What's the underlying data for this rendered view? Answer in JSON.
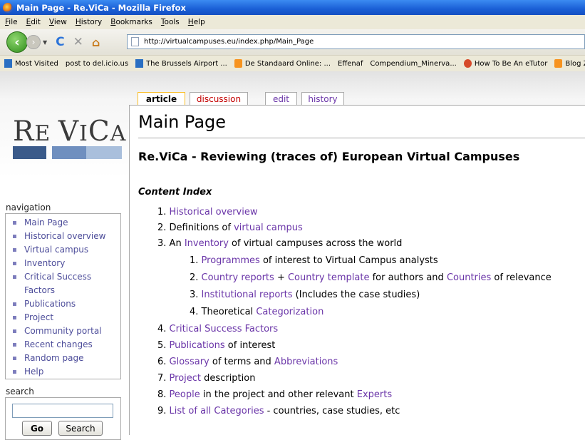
{
  "window": {
    "title": "Main Page - Re.ViCa - Mozilla Firefox"
  },
  "menu": [
    "File",
    "Edit",
    "View",
    "History",
    "Bookmarks",
    "Tools",
    "Help"
  ],
  "address": {
    "url": "http://virtualcampuses.eu/index.php/Main_Page"
  },
  "bookmarks": [
    {
      "label": "Most Visited",
      "icon": "blue"
    },
    {
      "label": "post to del.icio.us",
      "icon": "page"
    },
    {
      "label": "The Brussels Airport ...",
      "icon": "blue"
    },
    {
      "label": "De Standaard Online: ...",
      "icon": "rss"
    },
    {
      "label": "Effenaf",
      "icon": "page"
    },
    {
      "label": "Compendium_Minerva...",
      "icon": "page"
    },
    {
      "label": "How To Be An eTutor",
      "icon": "owl"
    },
    {
      "label": "Blog Zonder N",
      "icon": "rss"
    }
  ],
  "logo": {
    "text_big1": "R",
    "text_small1": "E ",
    "text_big2": "V",
    "text_small2": "I",
    "text_big3": "C",
    "text_small3": "A",
    "colors": [
      "#3a5a8a",
      "#6f8fbf",
      "#a9bfdc"
    ]
  },
  "tabs": {
    "article": "article",
    "discussion": "discussion",
    "edit": "edit",
    "history": "history"
  },
  "sidebar": {
    "navigation_title": "navigation",
    "items": [
      "Main Page",
      "Historical overview",
      "Virtual campus",
      "Inventory",
      "Critical Success",
      "Factors",
      "Publications",
      "Project",
      "Community portal",
      "Recent changes",
      "Random page",
      "Help"
    ],
    "search_title": "search",
    "go_label": "Go",
    "search_label": "Search"
  },
  "content": {
    "title": "Main Page",
    "subtitle": "Re.ViCa - Reviewing (traces of) European Virtual Campuses",
    "index_heading": "Content Index",
    "items": {
      "i1": {
        "num": "1.",
        "link": "Historical overview"
      },
      "i2": {
        "num": "2.",
        "text": "Definitions of ",
        "link": "virtual campus"
      },
      "i3": {
        "num": "3.",
        "text": "An ",
        "link": "Inventory",
        "text2": " of virtual campuses across the world"
      },
      "i3_1": {
        "num": "1.",
        "link": "Programmes",
        "text": " of interest to Virtual Campus analysts"
      },
      "i3_2": {
        "num": "2.",
        "link": "Country reports",
        "text": " + ",
        "link2": "Country template",
        "text2": " for authors and ",
        "link3": "Countries",
        "text3": " of relevance"
      },
      "i3_3": {
        "num": "3.",
        "link": "Institutional reports",
        "text": " (Includes the case studies)"
      },
      "i3_4": {
        "num": "4.",
        "text": "Theoretical ",
        "link": "Categorization"
      },
      "i4": {
        "num": "4.",
        "link": "Critical Success Factors"
      },
      "i5": {
        "num": "5.",
        "link": "Publications",
        "text": " of interest"
      },
      "i6": {
        "num": "6.",
        "link": "Glossary",
        "text": " of terms and ",
        "link2": "Abbreviations"
      },
      "i7": {
        "num": "7.",
        "link": "Project",
        "text": " description"
      },
      "i8": {
        "num": "8.",
        "link": "People",
        "text": " in the project and other relevant ",
        "link2": "Experts"
      },
      "i9": {
        "num": "9.",
        "link": "List of all Categories",
        "text": " - countries, case studies, etc"
      }
    }
  }
}
